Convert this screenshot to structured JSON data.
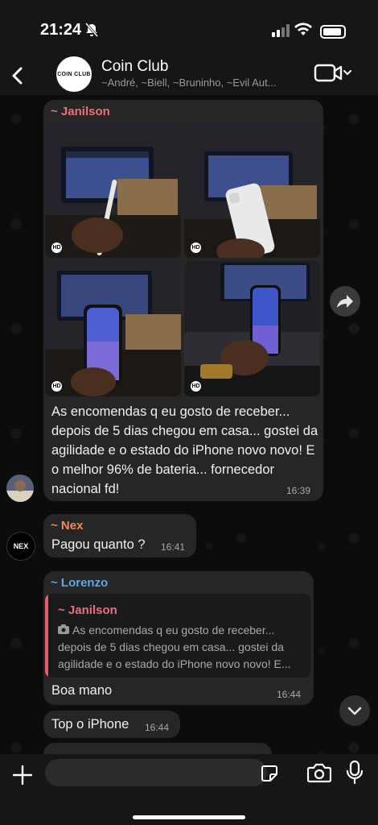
{
  "status_bar": {
    "time": "21:24"
  },
  "header": {
    "group_avatar_text": "COIN CLUB",
    "title": "Coin Club",
    "subtitle": "~André, ~Biell, ~Bruninho, ~Evil Aut..."
  },
  "messages": {
    "janilson": {
      "sender": "~ Janilson",
      "sender_color": "#e8707f",
      "photo_badges": [
        "HD",
        "HD",
        "HD",
        "HD"
      ],
      "text": "As encomendas q eu gosto de receber... depois de 5 dias chegou em casa... gostei da agilidade e o estado do iPhone novo novo!  E o melhor 96% de bateria... fornecedor nacional fd!",
      "time": "16:39"
    },
    "nex": {
      "sender": "~ Nex",
      "sender_color": "#f0895a",
      "avatar_text": "NEX",
      "text": "Pagou quanto ?",
      "time": "16:41"
    },
    "lorenzo": {
      "sender": "~ Lorenzo",
      "sender_color": "#5aa7ea",
      "quote_sender": "~ Janilson",
      "quote_text": "As encomendas q eu gosto de receber... depois de 5 dias chegou em casa... gostei da agilidade e o estado do iPhone novo novo!  E...",
      "text": "Boa mano",
      "time": "16:44"
    },
    "lorenzo2": {
      "text": "Top o iPhone",
      "time": "16:44"
    }
  },
  "composer": {
    "placeholder": ""
  },
  "colors": {
    "accent": "#e8707f",
    "bubble": "#262626",
    "background": "#0c0c0c"
  },
  "icons": [
    "back-chevron-icon",
    "video-camera-icon",
    "forward-icon",
    "scroll-down-icon",
    "plus-icon",
    "sticker-icon",
    "camera-icon",
    "mic-icon"
  ]
}
